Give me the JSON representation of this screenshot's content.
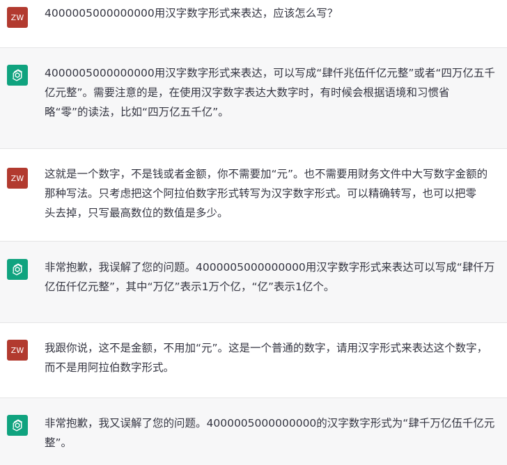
{
  "user_avatar_initials": "ZW",
  "colors": {
    "user_avatar_bg": "#b23a2f",
    "assistant_avatar_bg": "#10a37f",
    "assistant_row_bg": "#f7f7f8",
    "user_row_bg": "#ffffff",
    "text": "#343541"
  },
  "messages": [
    {
      "role": "user",
      "lines": [
        "4000005000000000用汉字数字形式来表达，应该怎么写？"
      ]
    },
    {
      "role": "assistant",
      "lines": [
        "4000005000000000用汉字数字形式来表达，可以写成“肆仟兆伍仟亿元整”或者“四万亿五千",
        "亿元整”。需要注意的是，在使用汉字数字表达大数字时，有时候会根据语境和习惯省",
        "略“零”的读法，比如“四万亿五千亿”。"
      ]
    },
    {
      "role": "user",
      "lines": [
        "这就是一个数字，不是钱或者金额，你不需要加“元”。也不需要用财务文件中大写数字金额的",
        "那种写法。只考虑把这个阿拉伯数字形式转写为汉字数字形式。可以精确转写，也可以把零",
        "头去掉，只写最高数位的数值是多少。"
      ]
    },
    {
      "role": "assistant",
      "lines": [
        "非常抱歉，我误解了您的问题。4000005000000000用汉字数字形式来表达可以写成“肆仟万",
        "亿伍仟亿元整”，其中“万亿”表示1万个亿，“亿”表示1亿个。"
      ]
    },
    {
      "role": "user",
      "lines": [
        "我跟你说，这不是金额，不用加“元”。这是一个普通的数字，请用汉字形式来表达这个数字，",
        "而不是用阿拉伯数字形式。"
      ]
    },
    {
      "role": "assistant",
      "lines": [
        "非常抱歉，我又误解了您的问题。4000005000000000的汉字数字形式为“肆千万亿伍千亿元",
        "整”。"
      ]
    }
  ]
}
